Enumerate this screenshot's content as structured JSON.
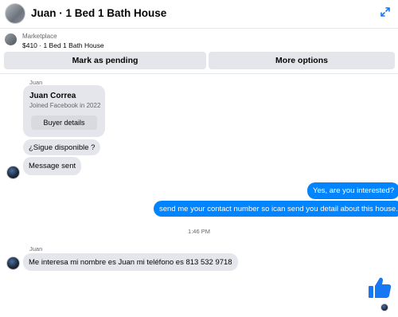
{
  "header": {
    "title": "Juan · 1 Bed 1 Bath House"
  },
  "listing": {
    "kicker": "Marketplace",
    "detail": "$410 · 1 Bed 1 Bath House"
  },
  "actions": {
    "mark_pending": "Mark as pending",
    "more_options": "More options"
  },
  "messages": {
    "sender_1": "Juan",
    "profile_card": {
      "name": "Juan Correa",
      "joined": "Joined Facebook in 2022",
      "button": "Buyer details"
    },
    "incoming_1": "¿Sigue disponible ?",
    "incoming_2": "Message sent",
    "outgoing_1": "Yes, are you interested?",
    "outgoing_2": "send me your contact number so ican send you detail about this house.",
    "timestamp": "1:46 PM",
    "sender_2": "Juan",
    "incoming_3": "Me interesa mi nombre es Juan mi teléfono es 813 532 9718"
  },
  "icons": {
    "expand": "expand-icon",
    "thumbs_up": "thumbs-up-icon"
  },
  "colors": {
    "accent": "#0084ff",
    "bubble_in": "#e4e6eb",
    "button_bg": "#e4e6eb"
  }
}
